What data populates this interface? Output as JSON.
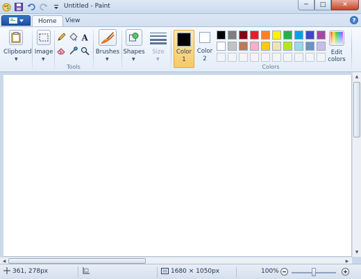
{
  "window": {
    "title": "Untitled - Paint",
    "buttons": {
      "minimize": "─",
      "maximize": "□",
      "close": "✕"
    }
  },
  "tabs": {
    "home": "Home",
    "view": "View"
  },
  "groups": {
    "clipboard": {
      "label": "Clipboard"
    },
    "image": {
      "label": "Image"
    },
    "tools": {
      "label": "Tools",
      "items": [
        "pencil",
        "fill",
        "text",
        "eraser",
        "color-picker",
        "magnifier"
      ]
    },
    "brushes": {
      "label": "Brushes"
    },
    "shapes": {
      "label": "Shapes"
    },
    "size": {
      "label": "Size"
    },
    "color1": {
      "label_line1": "Color",
      "label_line2": "1",
      "value": "#000000"
    },
    "color2": {
      "label_line1": "Color",
      "label_line2": "2",
      "value": "#ffffff"
    },
    "colors": {
      "label": "Colors",
      "row1": [
        "#000000",
        "#7f7f7f",
        "#880015",
        "#ed1c24",
        "#ff7f27",
        "#fff200",
        "#22b14c",
        "#00a2e8",
        "#3f48cc",
        "#a349a4"
      ],
      "row2": [
        "#ffffff",
        "#c3c3c3",
        "#b97a57",
        "#ffaec9",
        "#ffc90e",
        "#efe4b0",
        "#b5e61d",
        "#99d9ea",
        "#7092be",
        "#c8bfe7"
      ]
    },
    "edit_colors": {
      "label_line1": "Edit",
      "label_line2": "colors"
    }
  },
  "status": {
    "cursor_position": "361, 278px",
    "image_size": "1680 × 1050px",
    "zoom": "100%",
    "zoom_level": 1.0
  }
}
